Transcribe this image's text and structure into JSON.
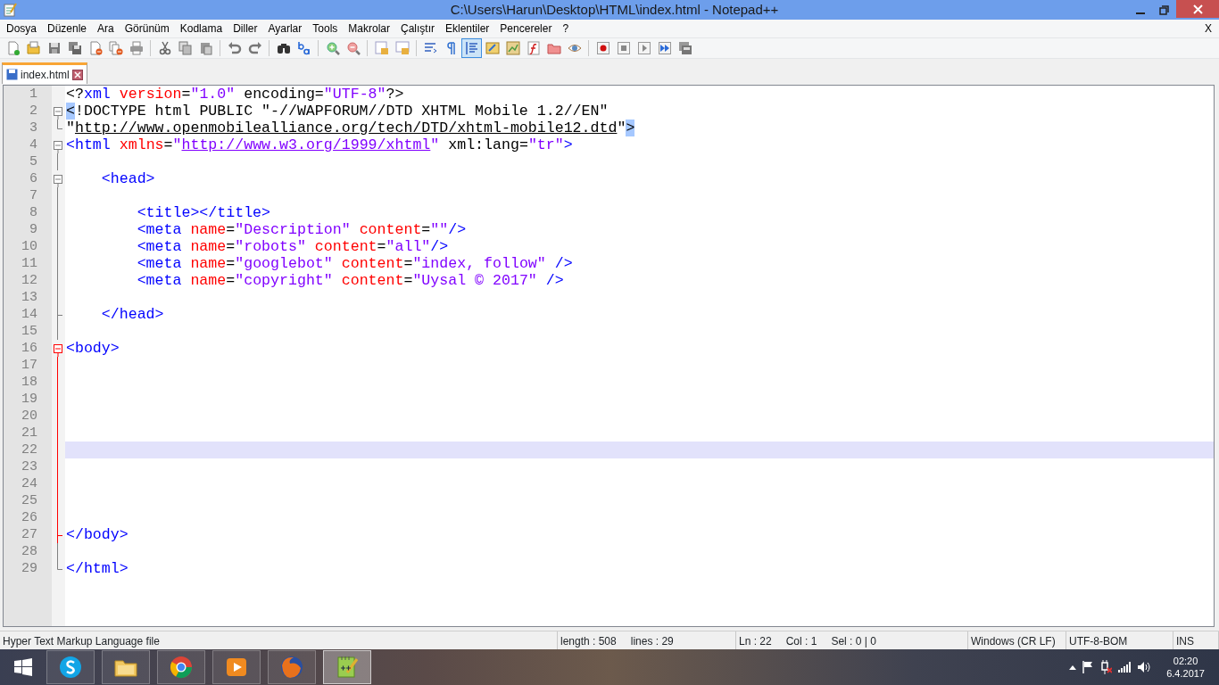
{
  "window": {
    "title": "C:\\Users\\Harun\\Desktop\\HTML\\index.html - Notepad++"
  },
  "menu": [
    "Dosya",
    "Düzenle",
    "Ara",
    "Görünüm",
    "Kodlama",
    "Diller",
    "Ayarlar",
    "Tools",
    "Makrolar",
    "Çalıştır",
    "Eklentiler",
    "Pencereler",
    "?"
  ],
  "menu_close": "X",
  "toolbar": [
    {
      "pressed": false
    },
    {
      "pressed": false
    },
    {
      "pressed": false
    },
    {
      "pressed": false
    },
    {
      "pressed": false
    },
    {
      "pressed": false
    },
    {
      "pressed": false
    },
    {
      "pressed": false
    },
    {
      "pressed": false
    },
    {
      "pressed": false
    },
    {
      "pressed": false
    },
    {
      "pressed": false
    },
    {
      "pressed": false
    },
    {
      "pressed": false
    },
    {
      "pressed": false
    },
    {
      "pressed": false
    },
    {
      "pressed": false
    },
    {
      "pressed": false
    },
    {
      "pressed": false
    },
    {
      "pressed": false
    },
    {
      "pressed": true
    },
    {
      "pressed": false
    },
    {
      "pressed": false
    },
    {
      "pressed": false
    },
    {
      "pressed": false
    },
    {
      "pressed": false
    },
    {
      "pressed": false
    },
    {
      "pressed": false
    },
    {
      "pressed": false
    },
    {
      "pressed": false
    },
    {
      "pressed": false
    }
  ],
  "tabs": [
    {
      "label": "index.html",
      "selected": true
    }
  ],
  "editor": {
    "lines": [
      {
        "number": "1",
        "kind": "none",
        "active_block": false,
        "current": false,
        "tokens": [
          {
            "text": "<?",
            "kind": "plain"
          },
          {
            "text": "xml",
            "kind": "tag"
          },
          {
            "text": " version",
            "kind": "attr"
          },
          {
            "text": "=",
            "kind": "plain"
          },
          {
            "text": "\"1.0\"",
            "kind": "string"
          },
          {
            "text": " encoding=",
            "kind": "plain"
          },
          {
            "text": "\"UTF-8\"",
            "kind": "string"
          },
          {
            "text": "?>",
            "kind": "plain"
          }
        ]
      },
      {
        "number": "2",
        "kind": "start",
        "active_block": false,
        "current": false,
        "tokens": [
          {
            "text": "<",
            "kind": "brace"
          },
          {
            "text": "!DOCTYPE html PUBLIC \"-//WAPFORUM//DTD XHTML Mobile 1.2//EN\"",
            "kind": "plain"
          }
        ]
      },
      {
        "number": "3",
        "kind": "end",
        "active_block": false,
        "current": false,
        "tokens": [
          {
            "text": "\"",
            "kind": "plain"
          },
          {
            "text": "http://www.openmobilealliance.org/tech/DTD/xhtml-mobile12.dtd",
            "kind": "link"
          },
          {
            "text": "\"",
            "kind": "plain"
          },
          {
            "text": ">",
            "kind": "brace"
          }
        ]
      },
      {
        "number": "4",
        "kind": "start",
        "active_block": false,
        "current": false,
        "tokens": [
          {
            "text": "<html",
            "kind": "tag"
          },
          {
            "text": " xmlns",
            "kind": "attr"
          },
          {
            "text": "=",
            "kind": "plain"
          },
          {
            "text": "\"",
            "kind": "string"
          },
          {
            "text": "http://www.w3.org/1999/xhtml",
            "kind": "url"
          },
          {
            "text": "\"",
            "kind": "string"
          },
          {
            "text": " xml:lang=",
            "kind": "plain"
          },
          {
            "text": "\"tr\"",
            "kind": "string"
          },
          {
            "text": ">",
            "kind": "tag"
          }
        ]
      },
      {
        "number": "5",
        "kind": "mid",
        "active_block": false,
        "current": false
      },
      {
        "number": "6",
        "kind": "start",
        "active_block": false,
        "current": false,
        "tokens": [
          {
            "text": "    <head>",
            "kind": "tag"
          }
        ]
      },
      {
        "number": "7",
        "kind": "mid",
        "active_block": false,
        "current": false
      },
      {
        "number": "8",
        "kind": "mid",
        "active_block": false,
        "current": false,
        "tokens": [
          {
            "text": "        <title></title>",
            "kind": "tag"
          }
        ]
      },
      {
        "number": "9",
        "kind": "mid",
        "active_block": false,
        "current": false,
        "tokens": [
          {
            "text": "        <meta",
            "kind": "tag"
          },
          {
            "text": " name",
            "kind": "attr"
          },
          {
            "text": "=",
            "kind": "plain"
          },
          {
            "text": "\"Description\"",
            "kind": "string"
          },
          {
            "text": " content",
            "kind": "attr"
          },
          {
            "text": "=",
            "kind": "plain"
          },
          {
            "text": "\"\"",
            "kind": "string"
          },
          {
            "text": "/>",
            "kind": "tag"
          }
        ]
      },
      {
        "number": "10",
        "kind": "mid",
        "active_block": false,
        "current": false,
        "tokens": [
          {
            "text": "        <meta",
            "kind": "tag"
          },
          {
            "text": " name",
            "kind": "attr"
          },
          {
            "text": "=",
            "kind": "plain"
          },
          {
            "text": "\"robots\"",
            "kind": "string"
          },
          {
            "text": " content",
            "kind": "attr"
          },
          {
            "text": "=",
            "kind": "plain"
          },
          {
            "text": "\"all\"",
            "kind": "string"
          },
          {
            "text": "/>",
            "kind": "tag"
          }
        ]
      },
      {
        "number": "11",
        "kind": "mid",
        "active_block": false,
        "current": false,
        "tokens": [
          {
            "text": "        <meta",
            "kind": "tag"
          },
          {
            "text": " name",
            "kind": "attr"
          },
          {
            "text": "=",
            "kind": "plain"
          },
          {
            "text": "\"googlebot\"",
            "kind": "string"
          },
          {
            "text": " content",
            "kind": "attr"
          },
          {
            "text": "=",
            "kind": "plain"
          },
          {
            "text": "\"index, follow\"",
            "kind": "string"
          },
          {
            "text": " />",
            "kind": "tag"
          }
        ]
      },
      {
        "number": "12",
        "kind": "mid",
        "active_block": false,
        "current": false,
        "tokens": [
          {
            "text": "        <meta",
            "kind": "tag"
          },
          {
            "text": " name",
            "kind": "attr"
          },
          {
            "text": "=",
            "kind": "plain"
          },
          {
            "text": "\"copyright\"",
            "kind": "string"
          },
          {
            "text": " content",
            "kind": "attr"
          },
          {
            "text": "=",
            "kind": "plain"
          },
          {
            "text": "\"Uysal © 2017\"",
            "kind": "string"
          },
          {
            "text": " />",
            "kind": "tag"
          }
        ]
      },
      {
        "number": "13",
        "kind": "mid",
        "active_block": false,
        "current": false
      },
      {
        "number": "14",
        "kind": "tail",
        "active_block": false,
        "current": false,
        "tokens": [
          {
            "text": "    </head>",
            "kind": "tag"
          }
        ]
      },
      {
        "number": "15",
        "kind": "mid",
        "active_block": false,
        "current": false
      },
      {
        "number": "16",
        "kind": "start",
        "active_block": true,
        "current": false,
        "tokens": [
          {
            "text": "<body>",
            "kind": "tag"
          }
        ]
      },
      {
        "number": "17",
        "kind": "mid",
        "active_block": true,
        "current": false
      },
      {
        "number": "18",
        "kind": "mid",
        "active_block": true,
        "current": false
      },
      {
        "number": "19",
        "kind": "mid",
        "active_block": true,
        "current": false
      },
      {
        "number": "20",
        "kind": "mid",
        "active_block": true,
        "current": false
      },
      {
        "number": "21",
        "kind": "mid",
        "active_block": true,
        "current": false
      },
      {
        "number": "22",
        "kind": "mid",
        "active_block": true,
        "current": true
      },
      {
        "number": "23",
        "kind": "mid",
        "active_block": true,
        "current": false
      },
      {
        "number": "24",
        "kind": "mid",
        "active_block": true,
        "current": false
      },
      {
        "number": "25",
        "kind": "mid",
        "active_block": true,
        "current": false
      },
      {
        "number": "26",
        "kind": "mid",
        "active_block": true,
        "current": false
      },
      {
        "number": "27",
        "kind": "tail",
        "active_block": true,
        "current": false,
        "tokens": [
          {
            "text": "</body>",
            "kind": "tag"
          }
        ]
      },
      {
        "number": "28",
        "kind": "mid",
        "active_block": false,
        "current": false
      },
      {
        "number": "29",
        "kind": "end",
        "active_block": false,
        "current": false,
        "tokens": [
          {
            "text": "</html>",
            "kind": "tag"
          }
        ]
      }
    ]
  },
  "status_bar": {
    "file_type": "Hyper Text Markup Language file",
    "length": "length : 508",
    "lines": "lines : 29",
    "ln": "Ln : 22",
    "col": "Col : 1",
    "sel": "Sel : 0 | 0",
    "eol": "Windows (CR LF)",
    "encoding": "UTF-8-BOM",
    "mode": "INS"
  },
  "taskbar": {
    "apps": [
      {
        "selected": false
      },
      {
        "selected": false
      },
      {
        "selected": false
      },
      {
        "selected": false
      },
      {
        "selected": false
      },
      {
        "selected": true
      }
    ],
    "clock": {
      "time": "02:20",
      "date": "6.4.2017"
    }
  }
}
